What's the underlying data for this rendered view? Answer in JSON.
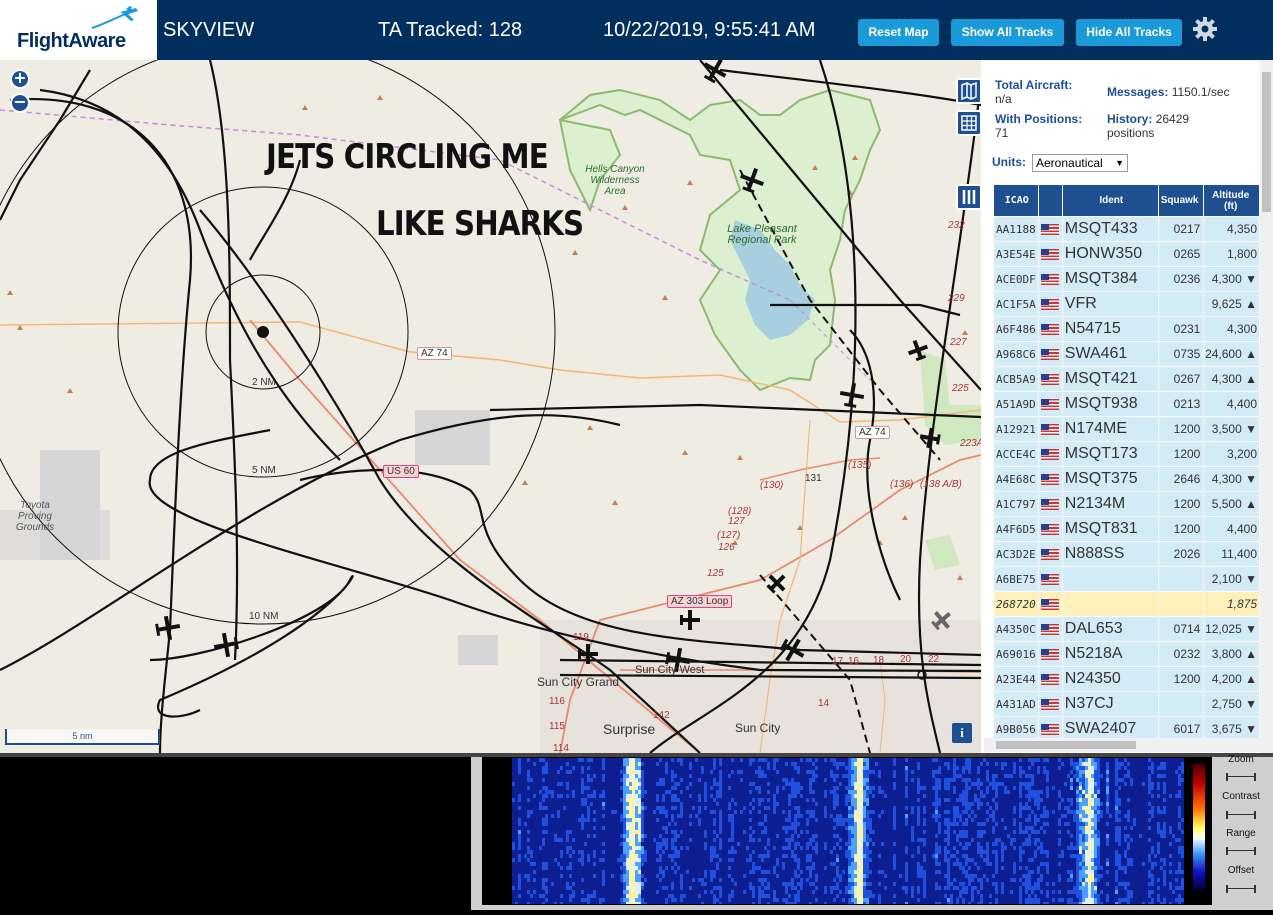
{
  "header": {
    "logo_text": "FlightAware",
    "app_name": "SKYVIEW",
    "tracked": "TA Tracked: 128",
    "datetime": "10/22/2019, 9:55:41 AM",
    "reset_map": "Reset Map",
    "show_all": "Show All Tracks",
    "hide_all": "Hide All Tracks",
    "settings_icon": "gear-icon"
  },
  "map": {
    "zoom_in": "+",
    "zoom_out": "−",
    "overlay_line1": "JETS CIRCLING ME",
    "overlay_line2": "LIKE SHARKS",
    "range_rings": [
      "2 NM",
      "5 NM",
      "10 NM"
    ],
    "park_labels": {
      "hells_canyon": "Hells Canyon Wilderness Area",
      "lake_pleasant": "Lake Pleasant Regional Park",
      "toyota": "Toyota Proving Grounds"
    },
    "roads": {
      "az74_a": "AZ 74",
      "az74_b": "AZ 74",
      "us60": "US 60",
      "az303": "AZ 303 Loop"
    },
    "places": {
      "sun_city_grand": "Sun City Grand",
      "sun_city_west": "Sun City West",
      "surprise": "Surprise",
      "sun_city": "Sun City"
    },
    "road_numbers": [
      "(130)",
      "131",
      "(135)",
      "(128)",
      "127",
      "(136)",
      "(138 A/B)",
      "125",
      "119",
      "116",
      "115",
      "114",
      "142",
      "14",
      "223A",
      "227",
      "225",
      "229",
      "232",
      "16",
      "18",
      "20",
      "22",
      "(127)",
      "126",
      "17"
    ],
    "scale": "5 nm",
    "info": "i"
  },
  "panel": {
    "total_aircraft_label": "Total Aircraft:",
    "total_aircraft_value": "n/a",
    "messages_label": "Messages:",
    "messages_value": "1150.1/sec",
    "with_positions_label": "With Positions:",
    "with_positions_value": "71",
    "history_label": "History:",
    "history_value": "26429",
    "history_unit": "positions",
    "units_label": "Units:",
    "units_value": "Aeronautical",
    "columns": {
      "icao": "ICAO",
      "ident": "Ident",
      "squawk": "Squawk",
      "altitude": "Altitude (ft)"
    },
    "rows": [
      {
        "icao": "AA1188",
        "ident": "MSQT433",
        "squawk": "0217",
        "alt": "4,350"
      },
      {
        "icao": "A3E54E",
        "ident": "HONW350",
        "squawk": "0265",
        "alt": "1,800"
      },
      {
        "icao": "ACE0DF",
        "ident": "MSQT384",
        "squawk": "0236",
        "alt": "4,300 ▼"
      },
      {
        "icao": "AC1F5A",
        "ident": "VFR",
        "squawk": "",
        "alt": "9,625 ▲"
      },
      {
        "icao": "A6F486",
        "ident": "N54715",
        "squawk": "0231",
        "alt": "4,300"
      },
      {
        "icao": "A968C6",
        "ident": "SWA461",
        "squawk": "0735",
        "alt": "24,600 ▲"
      },
      {
        "icao": "ACB5A9",
        "ident": "MSQT421",
        "squawk": "0267",
        "alt": "4,300 ▲"
      },
      {
        "icao": "A51A9D",
        "ident": "MSQT938",
        "squawk": "0213",
        "alt": "4,400"
      },
      {
        "icao": "A12921",
        "ident": "N174ME",
        "squawk": "1200",
        "alt": "3,500 ▼"
      },
      {
        "icao": "ACCE4C",
        "ident": "MSQT173",
        "squawk": "1200",
        "alt": "3,200"
      },
      {
        "icao": "A4E68C",
        "ident": "MSQT375",
        "squawk": "2646",
        "alt": "4,300 ▼"
      },
      {
        "icao": "A1C797",
        "ident": "N2134M",
        "squawk": "1200",
        "alt": "5,500 ▲"
      },
      {
        "icao": "A4F6D5",
        "ident": "MSQT831",
        "squawk": "1200",
        "alt": "4,400"
      },
      {
        "icao": "AC3D2E",
        "ident": "N888SS",
        "squawk": "2026",
        "alt": "11,400"
      },
      {
        "icao": "A6BE75",
        "ident": "",
        "squawk": "",
        "alt": "2,100 ▼"
      },
      {
        "icao": "268720",
        "ident": "",
        "squawk": "",
        "alt": "1,875",
        "selected": true
      },
      {
        "icao": "A4350C",
        "ident": "DAL653",
        "squawk": "0714",
        "alt": "12,025 ▼"
      },
      {
        "icao": "A69016",
        "ident": "N5218A",
        "squawk": "0232",
        "alt": "3,800 ▲"
      },
      {
        "icao": "A23E44",
        "ident": "N24350",
        "squawk": "1200",
        "alt": "4,200 ▲"
      },
      {
        "icao": "A431AD",
        "ident": "N37CJ",
        "squawk": "",
        "alt": "2,750 ▼"
      },
      {
        "icao": "A9B056",
        "ident": "SWA2407",
        "squawk": "6017",
        "alt": "3,675 ▼"
      }
    ]
  },
  "waterfall": {
    "zoom": "Zoom",
    "contrast": "Contrast",
    "range": "Range",
    "offset": "Offset"
  },
  "colors": {
    "header_bg": "#002f5d",
    "button_bg": "#1a9ad9",
    "table_header": "#1d4f91",
    "row_bg": "#d3eaf7",
    "row_selected": "#fdf0b8",
    "map_bg": "#efece3"
  }
}
